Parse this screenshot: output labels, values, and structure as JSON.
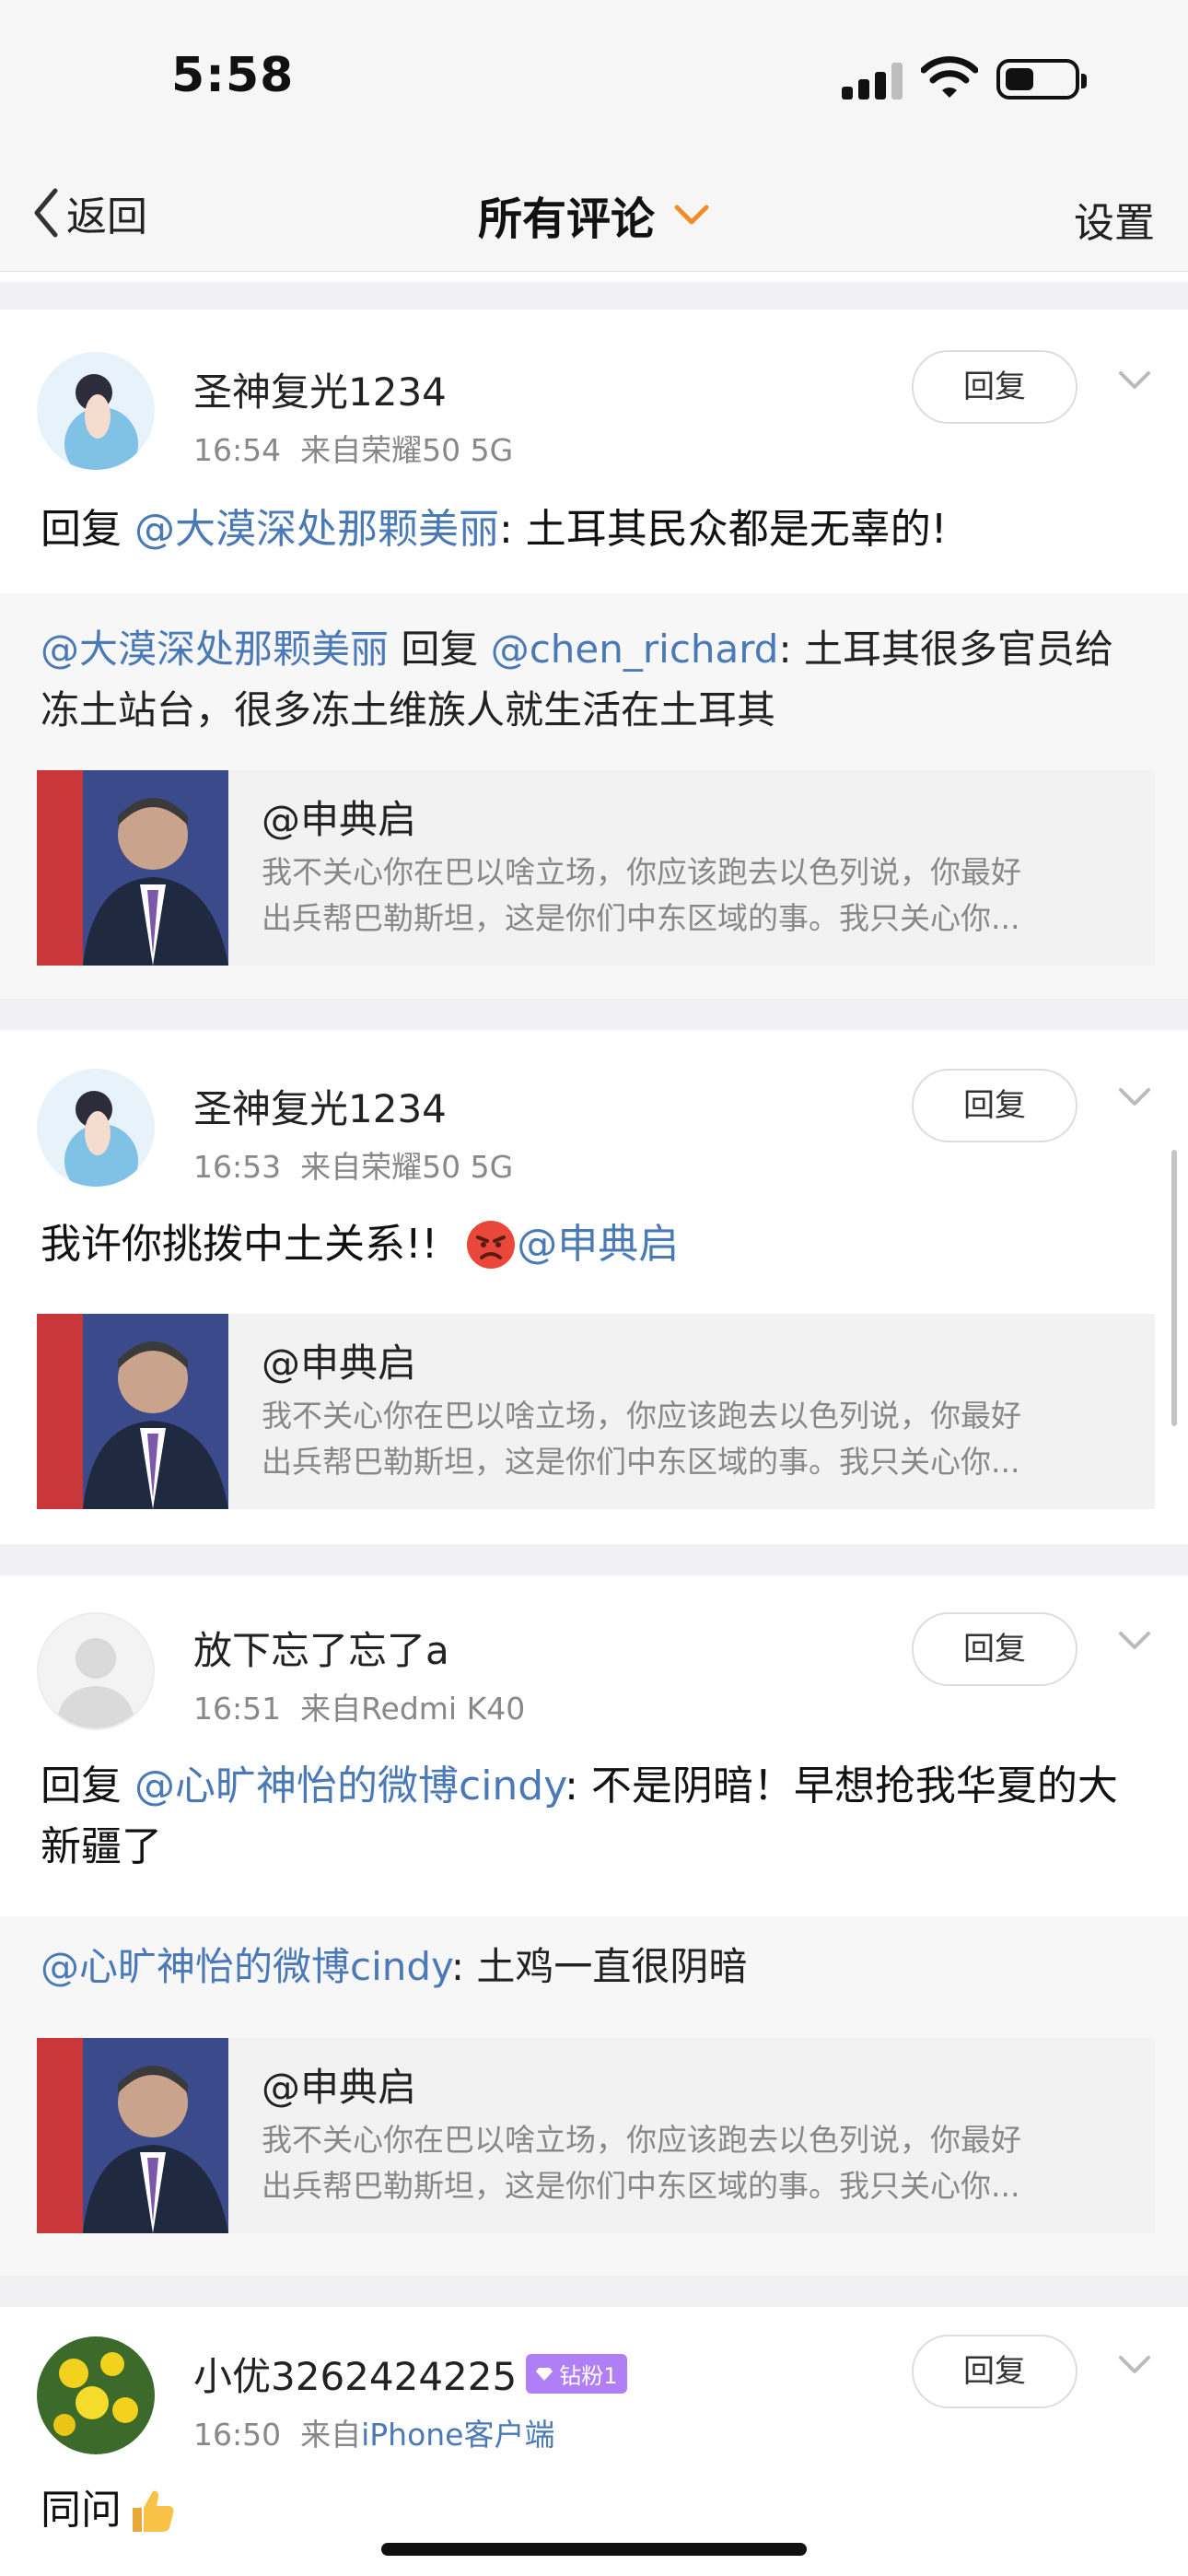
{
  "status_bar": {
    "time": "5:58"
  },
  "nav": {
    "back_label": "返回",
    "title": "所有评论",
    "settings_label": "设置"
  },
  "comments": [
    {
      "username": "圣神复光1234",
      "time": "16:54",
      "source_prefix": "来自",
      "source": "荣耀50 5G",
      "reply_button": "回复",
      "content_prefix": "回复 ",
      "content_mention": "@大漠深处那颗美丽",
      "content_text": ": 土耳其民众都是无辜的!",
      "quote_mention": "@大漠深处那颗美丽",
      "quote_middle": " 回复 ",
      "quote_mention2": "@chen_richard",
      "quote_text": ": 土耳其很多官员给冻土站台，很多冻土维族人就生活在土耳其",
      "card_title": "@申典启",
      "card_desc": "我不关心你在巴以啥立场，你应该跑去以色列说，你最好\n出兵帮巴勒斯坦，这是你们中东区域的事。我只关心你..."
    },
    {
      "username": "圣神复光1234",
      "time": "16:53",
      "source_prefix": "来自",
      "source": "荣耀50 5G",
      "reply_button": "回复",
      "content_text": "我许你挑拨中土关系!!",
      "content_mention": "@申典启",
      "card_title": "@申典启",
      "card_desc": "我不关心你在巴以啥立场，你应该跑去以色列说，你最好\n出兵帮巴勒斯坦，这是你们中东区域的事。我只关心你..."
    },
    {
      "username": "放下忘了忘了a",
      "time": "16:51",
      "source_prefix": "来自",
      "source": "Redmi K40",
      "reply_button": "回复",
      "content_prefix": "回复 ",
      "content_mention": "@心旷神怡的微博cindy",
      "content_text": ": 不是阴暗！早想抢我华夏的大新疆了",
      "quote_mention": "@心旷神怡的微博cindy",
      "quote_text": ": 土鸡一直很阴暗",
      "card_title": "@申典启",
      "card_desc": "我不关心你在巴以啥立场，你应该跑去以色列说，你最好\n出兵帮巴勒斯坦，这是你们中东区域的事。我只关心你..."
    },
    {
      "username": "小优3262424225",
      "badge": "钻粉1",
      "time": "16:50",
      "source_prefix": "来自",
      "source": "iPhone客户端",
      "reply_button": "回复",
      "content_text": "同问"
    }
  ],
  "colors": {
    "link": "#4a79b8",
    "accent_orange": "#f08c2a",
    "badge": "#b07ef5"
  }
}
